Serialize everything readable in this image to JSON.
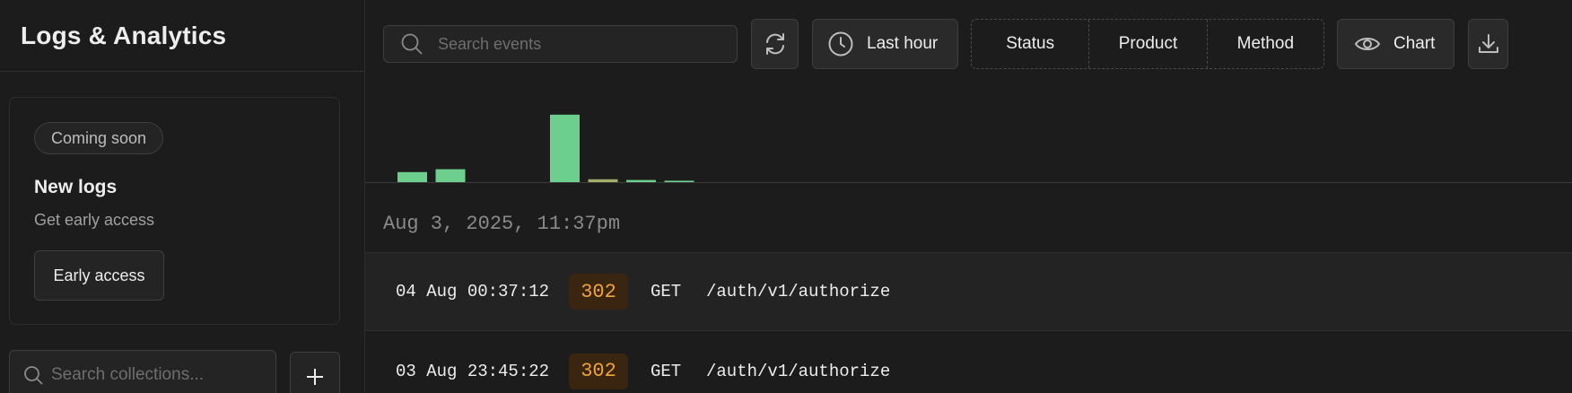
{
  "sidebar": {
    "title": "Logs & Analytics",
    "promo": {
      "badge": "Coming soon",
      "title": "New logs",
      "subtitle": "Get early access",
      "button": "Early access"
    },
    "collection_search": {
      "placeholder": "Search collections..."
    },
    "add_icon": "plus-icon"
  },
  "toolbar": {
    "search": {
      "placeholder": "Search events",
      "icon": "search-icon"
    },
    "refresh_icon": "refresh-icon",
    "time_range": {
      "label": "Last hour",
      "icon": "clock-icon"
    },
    "filters": [
      "Status",
      "Product",
      "Method"
    ],
    "chart": {
      "label": "Chart",
      "icon": "eye-icon"
    },
    "download_icon": "download-icon"
  },
  "histogram": {
    "bars": [
      {
        "value": 14,
        "color": "#6ccf8e"
      },
      {
        "value": 18,
        "color": "#6ccf8e"
      },
      {
        "value": 0,
        "color": "#6ccf8e"
      },
      {
        "value": 0,
        "color": "#6ccf8e"
      },
      {
        "value": 94,
        "color": "#6ccf8e"
      },
      {
        "value": 4,
        "color": "#a3b06a"
      },
      {
        "value": 3,
        "color": "#6ccf8e"
      },
      {
        "value": 2,
        "color": "#6ccf8e"
      }
    ],
    "max": 100
  },
  "date_heading": "Aug 3, 2025, 11:37pm",
  "log_rows": [
    {
      "time": "04 Aug 00:37:12",
      "status": "302",
      "method": "GET",
      "path": "/auth/v1/authorize"
    },
    {
      "time": "03 Aug 23:45:22",
      "status": "302",
      "method": "GET",
      "path": "/auth/v1/authorize"
    }
  ],
  "colors": {
    "background": "#1c1c1c",
    "border": "#2e2e2e",
    "accent_green": "#6ccf8e",
    "status_302_text": "#f0a23c",
    "status_302_bg": "#3a2510"
  }
}
